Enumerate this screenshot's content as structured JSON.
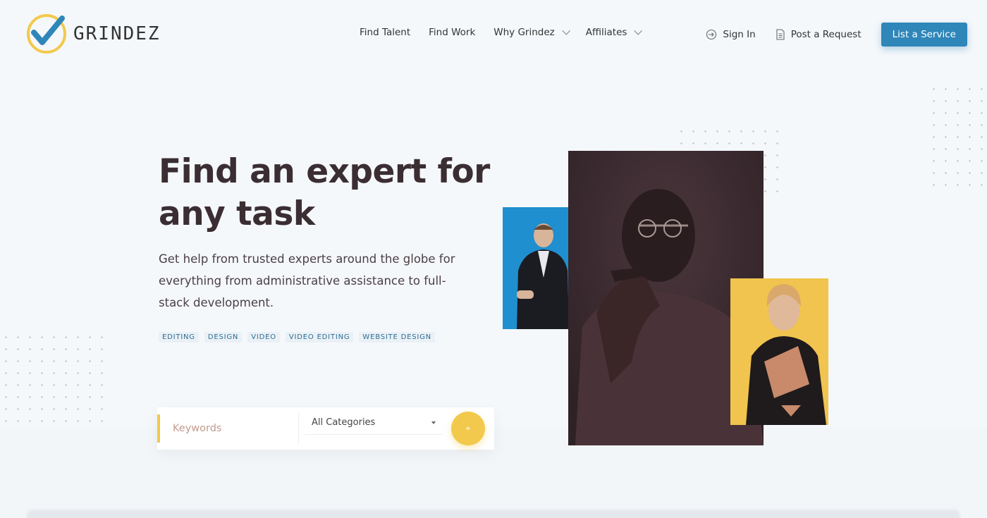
{
  "brand": {
    "name": "GRINDEZ"
  },
  "nav": {
    "items": [
      {
        "label": "Find Talent",
        "dropdown": false
      },
      {
        "label": "Find Work",
        "dropdown": false
      },
      {
        "label": "Why Grindez",
        "dropdown": true
      },
      {
        "label": "Affiliates",
        "dropdown": true
      }
    ],
    "sign_in": "Sign In",
    "post_request": "Post a Request",
    "cta": "List a Service"
  },
  "hero": {
    "title_line1": "Find an expert for",
    "title_line2": "any task",
    "subtitle": "Get help from trusted experts around the globe for everything from administrative assistance to full-stack development.",
    "tags": [
      "EDITING",
      "DESIGN",
      "VIDEO",
      "VIDEO EDITING",
      "WEBSITE DESIGN"
    ]
  },
  "search": {
    "keywords_placeholder": "Keywords",
    "category_selected": "All Categories",
    "submit_icon": "search-icon"
  },
  "colors": {
    "accent_blue": "#2f86b9",
    "accent_yellow": "#f2c94c",
    "photo_dark": "#3a2a30",
    "photo_blue": "#1c8ac9",
    "photo_yellow": "#f0c44e"
  }
}
